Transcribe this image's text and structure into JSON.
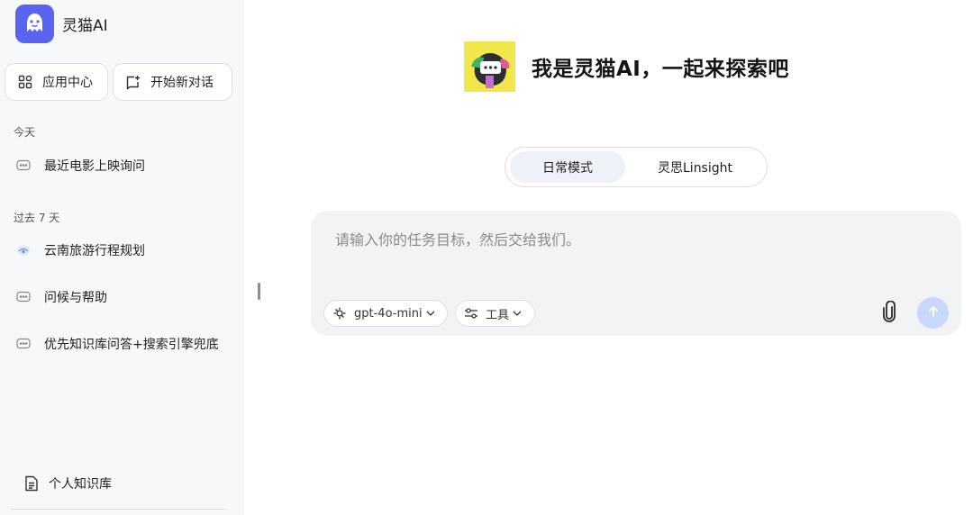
{
  "app": {
    "name": "灵猫AI"
  },
  "sidebar": {
    "app_center_label": "应用中心",
    "new_chat_label": "开始新对话",
    "sections": [
      {
        "label": "今天",
        "items": [
          {
            "title": "最近电影上映询问",
            "icon": "chat-bubble-icon"
          }
        ]
      },
      {
        "label": "过去 7 天",
        "items": [
          {
            "title": "云南旅游行程规划",
            "icon": "travel-icon"
          },
          {
            "title": "问候与帮助",
            "icon": "chat-bubble-icon"
          },
          {
            "title": "优先知识库问答+搜索引擎兜底",
            "icon": "chat-bubble-icon"
          }
        ]
      }
    ],
    "knowledge_base_label": "个人知识库"
  },
  "main": {
    "greeting": "我是灵猫AI，一起来探索吧",
    "modes": [
      {
        "label": "日常模式",
        "active": true
      },
      {
        "label": "灵思Linsight",
        "active": false
      }
    ],
    "composer": {
      "placeholder": "请输入你的任务目标，然后交给我们。",
      "model_label": "gpt-4o-mini",
      "tools_label": "工具"
    }
  },
  "colors": {
    "brand": "#5a64f0",
    "sidebar_bg": "#f7f8fa",
    "composer_bg": "#f2f3f5",
    "active_mode_bg": "#eef1f8",
    "send_button_disabled": "#c8d8fb"
  }
}
